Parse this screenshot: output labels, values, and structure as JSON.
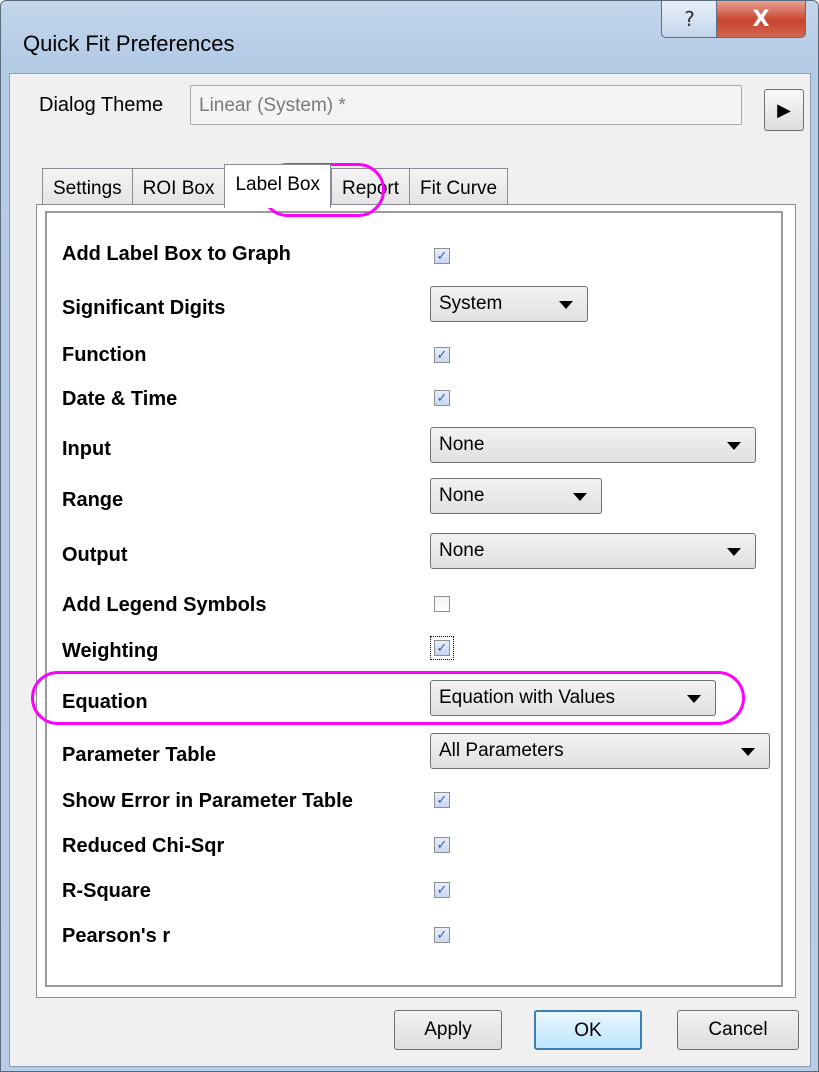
{
  "window": {
    "title": "Quick Fit Preferences",
    "help_icon": "?",
    "close_icon": "X"
  },
  "theme": {
    "label": "Dialog Theme",
    "value": "Linear (System) *",
    "arrow_icon": "▶"
  },
  "tabs": [
    {
      "label": "Settings"
    },
    {
      "label": "ROI Box"
    },
    {
      "label": "Label Box"
    },
    {
      "label": "Report"
    },
    {
      "label": "Fit Curve"
    }
  ],
  "rows": {
    "add_label_box": {
      "label": "Add Label Box to Graph",
      "checked": true
    },
    "significant_digits": {
      "label": "Significant Digits",
      "value": "System"
    },
    "function": {
      "label": "Function",
      "checked": true
    },
    "date_time": {
      "label": "Date & Time",
      "checked": true
    },
    "input": {
      "label": "Input",
      "value": "None"
    },
    "range": {
      "label": "Range",
      "value": "None"
    },
    "output": {
      "label": "Output",
      "value": "None"
    },
    "legend_symbols": {
      "label": "Add Legend Symbols",
      "checked": false
    },
    "weighting": {
      "label": "Weighting",
      "checked": true
    },
    "equation": {
      "label": "Equation",
      "value": "Equation with Values"
    },
    "parameter_table": {
      "label": "Parameter Table",
      "value": "All Parameters"
    },
    "show_error": {
      "label": "Show Error in Parameter Table",
      "checked": true
    },
    "reduced_chi": {
      "label": "Reduced Chi-Sqr",
      "checked": true
    },
    "r_square": {
      "label": "R-Square",
      "checked": true
    },
    "pearson": {
      "label": "Pearson's r",
      "checked": true
    }
  },
  "check_glyph": "✓",
  "buttons": {
    "apply": "Apply",
    "ok": "OK",
    "cancel": "Cancel"
  },
  "colors": {
    "highlight": "#ff00ff",
    "titlebar": "#b9cfe8"
  }
}
